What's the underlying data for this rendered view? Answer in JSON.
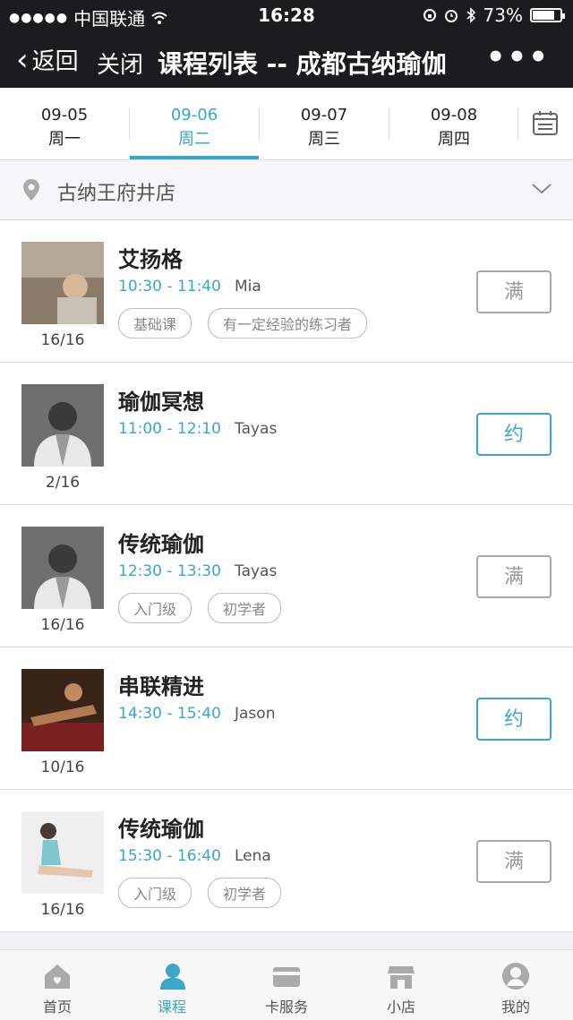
{
  "status_bar": {
    "signal": "●●●●●",
    "carrier": "中国联通",
    "time": "16:28",
    "battery": "73%"
  },
  "nav": {
    "back_label": "返回",
    "close_label": "关闭",
    "title": "课程列表 -- 成都古纳瑜伽",
    "more": "•••"
  },
  "dates": [
    {
      "date": "09-05",
      "weekday": "周一",
      "active": false
    },
    {
      "date": "09-06",
      "weekday": "周二",
      "active": true
    },
    {
      "date": "09-07",
      "weekday": "周三",
      "active": false
    },
    {
      "date": "09-08",
      "weekday": "周四",
      "active": false
    }
  ],
  "store": {
    "name": "古纳王府井店"
  },
  "classes": [
    {
      "name": "艾扬格",
      "time": "10:30 - 11:40",
      "teacher": "Mia",
      "count": "16/16",
      "tags": [
        "基础课",
        "有一定经验的练习者"
      ],
      "action": "满",
      "available": false
    },
    {
      "name": "瑜伽冥想",
      "time": "11:00 - 12:10",
      "teacher": "Tayas",
      "count": "2/16",
      "tags": [],
      "action": "约",
      "available": true
    },
    {
      "name": "传统瑜伽",
      "time": "12:30 - 13:30",
      "teacher": "Tayas",
      "count": "16/16",
      "tags": [
        "入门级",
        "初学者"
      ],
      "action": "满",
      "available": false
    },
    {
      "name": "串联精进",
      "time": "14:30 - 15:40",
      "teacher": "Jason",
      "count": "10/16",
      "tags": [],
      "action": "约",
      "available": true
    },
    {
      "name": "传统瑜伽",
      "time": "15:30 - 16:40",
      "teacher": "Lena",
      "count": "16/16",
      "tags": [
        "入门级",
        "初学者"
      ],
      "action": "满",
      "available": false
    }
  ],
  "tabbar": [
    {
      "label": "首页",
      "icon": "home-icon",
      "active": false
    },
    {
      "label": "课程",
      "icon": "user-icon",
      "active": true
    },
    {
      "label": "卡服务",
      "icon": "card-icon",
      "active": false
    },
    {
      "label": "小店",
      "icon": "shop-icon",
      "active": false
    },
    {
      "label": "我的",
      "icon": "profile-icon",
      "active": false
    }
  ],
  "colors": {
    "accent": "#3aa6c9",
    "nav_bg": "#1c1c1e"
  }
}
